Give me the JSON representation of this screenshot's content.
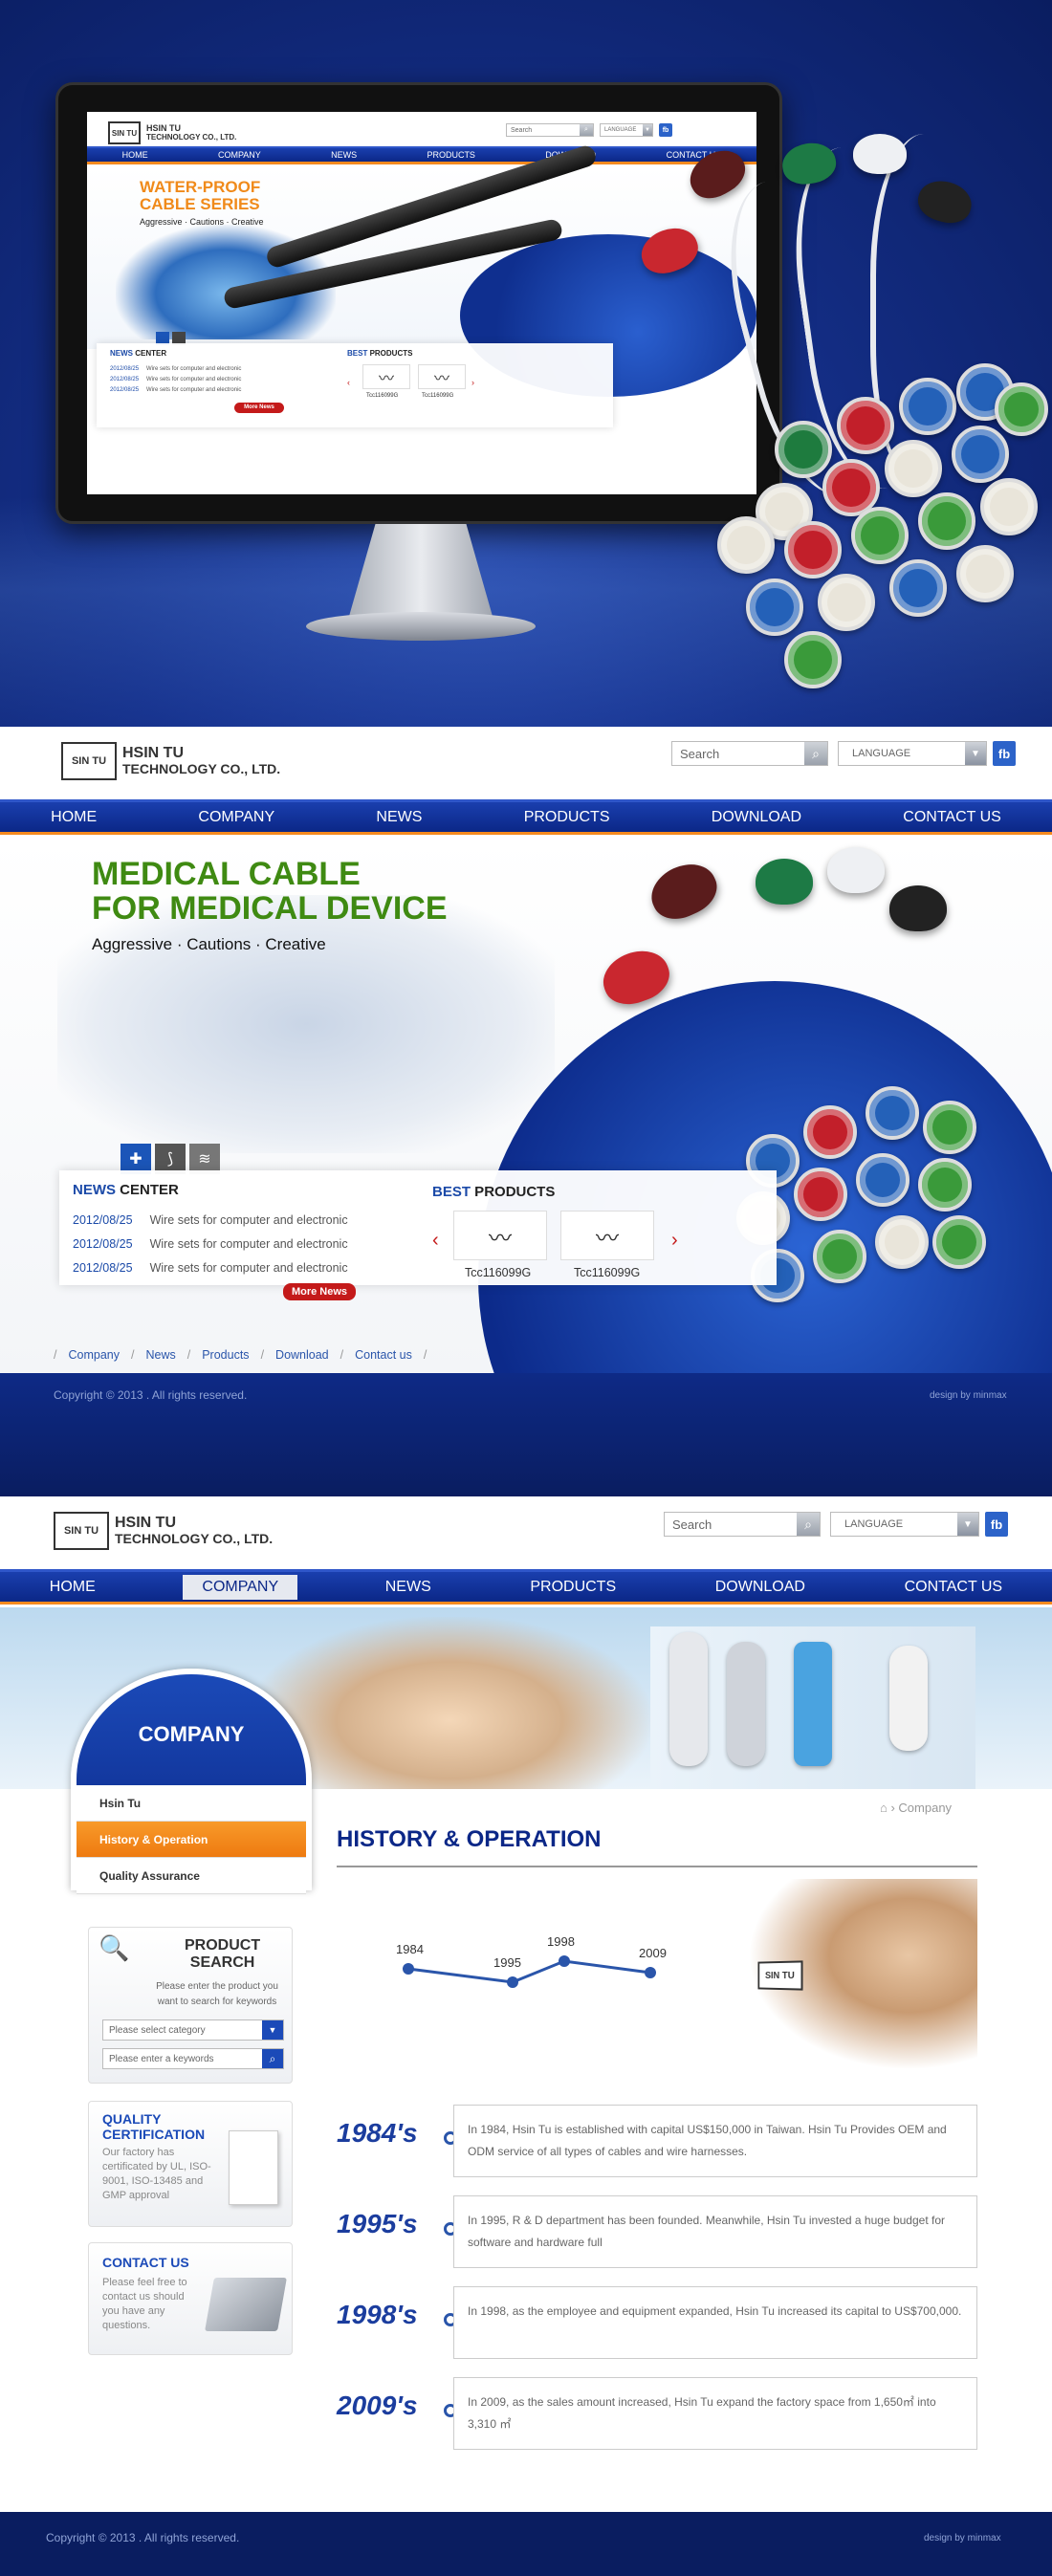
{
  "brand": {
    "logo_mark": "SIN TU",
    "name_line1": "HSIN TU",
    "name_line2": "TECHNOLOGY CO., LTD."
  },
  "header": {
    "search_placeholder": "Search",
    "language_label": "LANGUAGE",
    "fb_label": "fb"
  },
  "nav": [
    "HOME",
    "COMPANY",
    "NEWS",
    "PRODUCTS",
    "DOWNLOAD",
    "CONTACT US"
  ],
  "mockup": {
    "banner_title_1": "WATER-PROOF",
    "banner_title_2": "CABLE SERIES",
    "tagline": "Aggressive · Cautions · Creative",
    "news_title_bold": "NEWS",
    "news_title_rest": " CENTER",
    "news": [
      {
        "date": "2012/08/25",
        "text": "Wire sets for computer and electronic"
      },
      {
        "date": "2012/08/25",
        "text": "Wire sets for computer and electronic"
      },
      {
        "date": "2012/08/25",
        "text": "Wire sets for computer and electronic"
      }
    ],
    "more_news": "More News",
    "best_bold": "BEST",
    "best_rest": " PRODUCTS",
    "products": [
      "Tcc116099G",
      "Tcc116099G"
    ]
  },
  "home": {
    "banner_title_1": "MEDICAL CABLE",
    "banner_title_2": "FOR MEDICAL DEVICE",
    "tagline": "Aggressive · Cautions · Creative",
    "news_title_bold": "NEWS",
    "news_title_rest": " CENTER",
    "news": [
      {
        "date": "2012/08/25",
        "text": "Wire sets for computer and electronic"
      },
      {
        "date": "2012/08/25",
        "text": "Wire sets for computer and electronic"
      },
      {
        "date": "2012/08/25",
        "text": "Wire sets for computer and electronic"
      }
    ],
    "more_news": "More News",
    "best_bold": "BEST",
    "best_rest": " PRODUCTS",
    "products": [
      "Tcc116099G",
      "Tcc116099G"
    ],
    "footer_links": [
      "Company",
      "News",
      "Products",
      "Download",
      "Contact us"
    ],
    "copyright": "Copyright © 2013 . All rights reserved.",
    "design_by": "design by minmax"
  },
  "company": {
    "sidebar_title": "COMPANY",
    "sidebar_items": [
      "Hsin Tu",
      "History & Operation",
      "Quality Assurance"
    ],
    "search_title_1": "PRODUCT",
    "search_title_2": "SEARCH",
    "search_desc": "Please enter the product you want to search for keywords",
    "category_placeholder": "Please select category",
    "keyword_placeholder": "Please enter a keywords",
    "quality_title_1": "QUALITY",
    "quality_title_2": "CERTIFICATION",
    "quality_desc": "Our factory has certificated by UL, ISO-9001, ISO-13485 and GMP approval",
    "contact_title": "CONTACT US",
    "contact_desc": "Please feel free to contact us should you have any questions.",
    "breadcrumb": "Company",
    "page_title": "HISTORY & OPERATION",
    "chart_years": [
      "1984",
      "1995",
      "1998",
      "2009"
    ],
    "timeline": [
      {
        "year": "1984's",
        "text": "In 1984, Hsin Tu is established with capital US$150,000 in Taiwan. Hsin Tu Provides OEM and ODM service of all types of cables and wire harnesses."
      },
      {
        "year": "1995's",
        "text": "In 1995, R & D department has been founded. Meanwhile, Hsin Tu invested a huge budget for software and hardware full"
      },
      {
        "year": "1998's",
        "text": "In 1998, as the employee and equipment expanded, Hsin Tu increased its capital to US$700,000."
      },
      {
        "year": "2009's",
        "text": "In 2009, as the sales amount increased, Hsin Tu expand the factory space from 1,650㎡ into 3,310 ㎡"
      }
    ],
    "copyright": "Copyright © 2013 . All rights reserved.",
    "design_by": "design by minmax"
  },
  "colors": {
    "nav_blue": "#0b2787",
    "accent_orange": "#f58a1f",
    "title_green": "#3f8a12",
    "dark_blue": "#0a1d60"
  }
}
